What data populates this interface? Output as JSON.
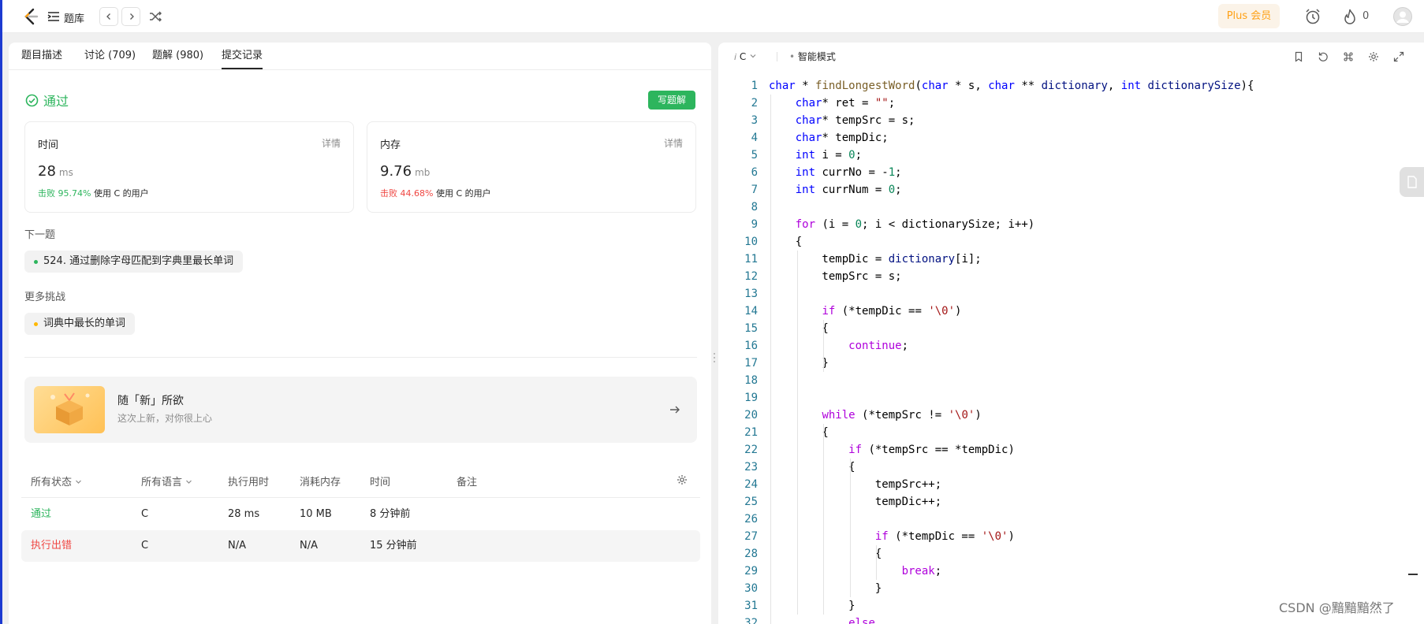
{
  "nav": {
    "title": "题库",
    "plus_label": "Plus 会员",
    "streak_count": "0"
  },
  "tabs": [
    {
      "label": "题目描述"
    },
    {
      "label": "讨论 (709)"
    },
    {
      "label": "题解 (980)"
    },
    {
      "label": "提交记录"
    }
  ],
  "result": {
    "status": "通过",
    "write_label": "写题解",
    "time_card": {
      "title": "时间",
      "detail": "详情",
      "value": "28",
      "unit": "ms",
      "beat_label": "击败 95.74%",
      "beat_suffix": "使用 C 的用户"
    },
    "mem_card": {
      "title": "内存",
      "detail": "详情",
      "value": "9.76",
      "unit": "mb",
      "beat_label": "击败 44.68%",
      "beat_suffix": "使用 C 的用户"
    }
  },
  "next": {
    "heading": "下一题",
    "item": "524. 通过删除字母匹配到字典里最长单词"
  },
  "more": {
    "heading": "更多挑战",
    "item": "词典中最长的单词"
  },
  "banner": {
    "title": "随「新」所欲",
    "subtitle": "这次上新，对你很上心"
  },
  "table": {
    "headers": [
      "所有状态",
      "所有语言",
      "执行用时",
      "消耗内存",
      "时间",
      "备注"
    ],
    "rows": [
      {
        "status": "通过",
        "lang": "C",
        "time": "28 ms",
        "mem": "10 MB",
        "ago": "8 分钟前"
      },
      {
        "status": "执行出错",
        "lang": "C",
        "time": "N/A",
        "mem": "N/A",
        "ago": "15 分钟前"
      }
    ]
  },
  "editor": {
    "lang": "C",
    "mode": "智能模式"
  },
  "watermark": "CSDN @黯黯黯然了",
  "colors": {
    "accent": "#ffa116",
    "success": "#2db55d",
    "error": "#ef4743"
  },
  "code_lines": [
    [
      [
        "k",
        "char"
      ],
      [
        "t",
        " * "
      ],
      [
        "f",
        "findLongestWord"
      ],
      [
        "t",
        "("
      ],
      [
        "k",
        "char"
      ],
      [
        "t",
        " * s, "
      ],
      [
        "k",
        "char"
      ],
      [
        "t",
        " ** "
      ],
      [
        "v",
        "dictionary"
      ],
      [
        "t",
        ", "
      ],
      [
        "k",
        "int"
      ],
      [
        "t",
        " "
      ],
      [
        "v",
        "dictionarySize"
      ],
      [
        "t",
        "){"
      ]
    ],
    [
      [
        "t",
        "    "
      ],
      [
        "k",
        "char"
      ],
      [
        "t",
        "* ret = "
      ],
      [
        "s",
        "\"\""
      ],
      [
        "t",
        ";"
      ]
    ],
    [
      [
        "t",
        "    "
      ],
      [
        "k",
        "char"
      ],
      [
        "t",
        "* tempSrc = s;"
      ]
    ],
    [
      [
        "t",
        "    "
      ],
      [
        "k",
        "char"
      ],
      [
        "t",
        "* tempDic;"
      ]
    ],
    [
      [
        "t",
        "    "
      ],
      [
        "k",
        "int"
      ],
      [
        "t",
        " i = "
      ],
      [
        "n",
        "0"
      ],
      [
        "t",
        ";"
      ]
    ],
    [
      [
        "t",
        "    "
      ],
      [
        "k",
        "int"
      ],
      [
        "t",
        " currNo = -"
      ],
      [
        "n",
        "1"
      ],
      [
        "t",
        ";"
      ]
    ],
    [
      [
        "t",
        "    "
      ],
      [
        "k",
        "int"
      ],
      [
        "t",
        " currNum = "
      ],
      [
        "n",
        "0"
      ],
      [
        "t",
        ";"
      ]
    ],
    [],
    [
      [
        "t",
        "    "
      ],
      [
        "p",
        "for"
      ],
      [
        "t",
        " (i = "
      ],
      [
        "n",
        "0"
      ],
      [
        "t",
        "; i < dictionarySize; i++)"
      ]
    ],
    [
      [
        "t",
        "    {"
      ]
    ],
    [
      [
        "t",
        "        tempDic = "
      ],
      [
        "v",
        "dictionary"
      ],
      [
        "t",
        "[i];"
      ]
    ],
    [
      [
        "t",
        "        tempSrc = s;"
      ]
    ],
    [],
    [
      [
        "t",
        "        "
      ],
      [
        "p",
        "if"
      ],
      [
        "t",
        " (*tempDic == "
      ],
      [
        "s",
        "'\\0'"
      ],
      [
        "t",
        ")"
      ]
    ],
    [
      [
        "t",
        "        {"
      ]
    ],
    [
      [
        "t",
        "            "
      ],
      [
        "p",
        "continue"
      ],
      [
        "t",
        ";"
      ]
    ],
    [
      [
        "t",
        "        }"
      ]
    ],
    [],
    [],
    [
      [
        "t",
        "        "
      ],
      [
        "p",
        "while"
      ],
      [
        "t",
        " (*tempSrc != "
      ],
      [
        "s",
        "'\\0'"
      ],
      [
        "t",
        ")"
      ]
    ],
    [
      [
        "t",
        "        {"
      ]
    ],
    [
      [
        "t",
        "            "
      ],
      [
        "p",
        "if"
      ],
      [
        "t",
        " (*tempSrc == *tempDic)"
      ]
    ],
    [
      [
        "t",
        "            {"
      ]
    ],
    [
      [
        "t",
        "                tempSrc++;"
      ]
    ],
    [
      [
        "t",
        "                tempDic++;"
      ]
    ],
    [],
    [
      [
        "t",
        "                "
      ],
      [
        "p",
        "if"
      ],
      [
        "t",
        " (*tempDic == "
      ],
      [
        "s",
        "'\\0'"
      ],
      [
        "t",
        ")"
      ]
    ],
    [
      [
        "t",
        "                {"
      ]
    ],
    [
      [
        "t",
        "                    "
      ],
      [
        "p",
        "break"
      ],
      [
        "t",
        ";"
      ]
    ],
    [
      [
        "t",
        "                }"
      ]
    ],
    [
      [
        "t",
        "            }"
      ]
    ],
    [
      [
        "t",
        "            "
      ],
      [
        "p",
        "else"
      ]
    ]
  ]
}
